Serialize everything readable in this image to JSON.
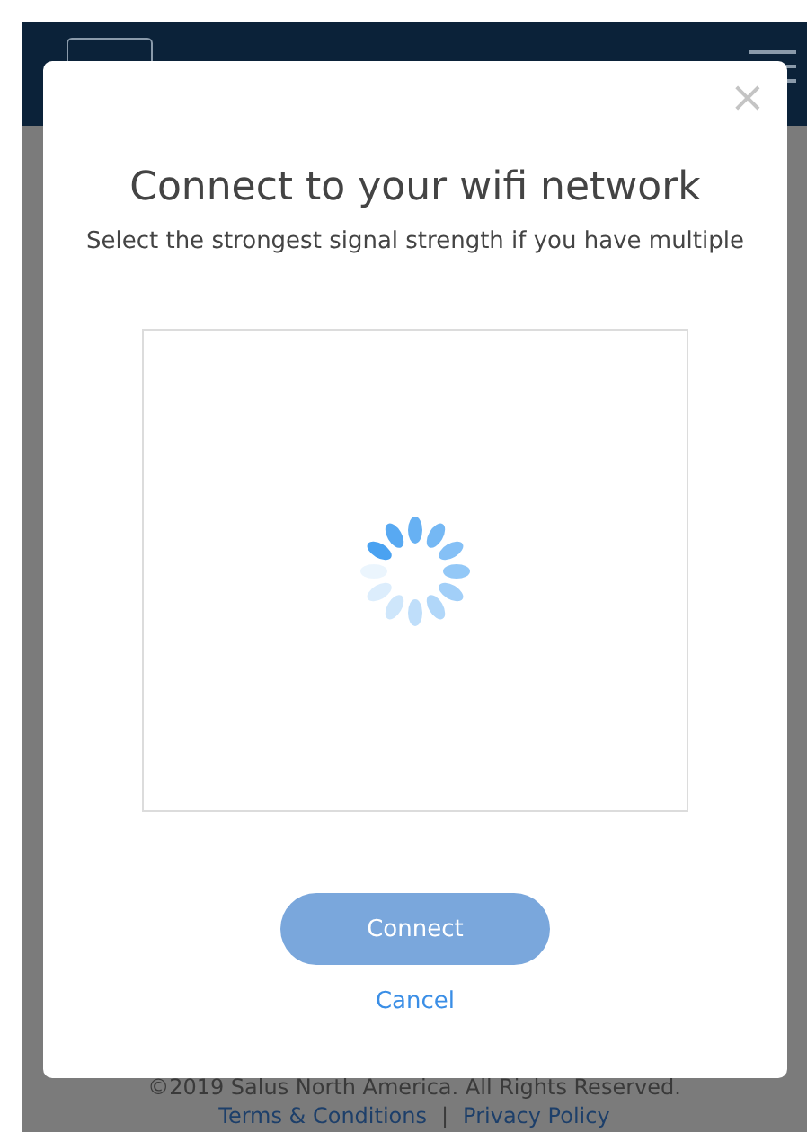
{
  "modal": {
    "close": "×",
    "title": "Connect to your wifi network",
    "subtitle": "Select the strongest signal strength if you have multiple",
    "connect_button": "Connect",
    "cancel_link": "Cancel"
  },
  "footer": {
    "copyright": "©2019    Salus North America. All Rights Reserved.",
    "links": [
      "Terms & Conditions",
      "Privacy Policy"
    ],
    "separator": "|"
  }
}
